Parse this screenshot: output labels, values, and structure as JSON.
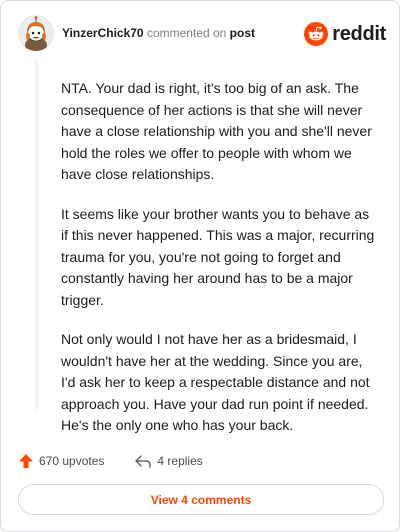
{
  "comment": {
    "username": "YinzerChick70",
    "action_text": "commented on",
    "target_link": "post",
    "paragraphs": [
      "NTA. Your dad is right, it's too big of an ask. The consequence of her actions is that she will never have a close relationship with you and she'll never hold the roles we offer to people with whom we have close relationships.",
      "It seems like your brother wants you to behave as if this never happened. This was a major, recurring trauma for you, you're not going to forget and constantly having her around has to be a major trigger.",
      "Not only would I not have her as a bridesmaid, I wouldn't have her at the wedding. Since you are, I'd ask her to keep a respectable distance and not approach you. Have your dad run point if needed. He's the only one who has your back."
    ]
  },
  "brand": {
    "wordmark": "reddit",
    "color": "#ff4500"
  },
  "actions": {
    "upvotes_label": "670 upvotes",
    "replies_label": "4 replies",
    "view_comments_label": "View 4 comments"
  },
  "icons": [
    "avatar",
    "reddit-logo-icon",
    "upvote-arrow-icon",
    "reply-arrow-icon"
  ]
}
